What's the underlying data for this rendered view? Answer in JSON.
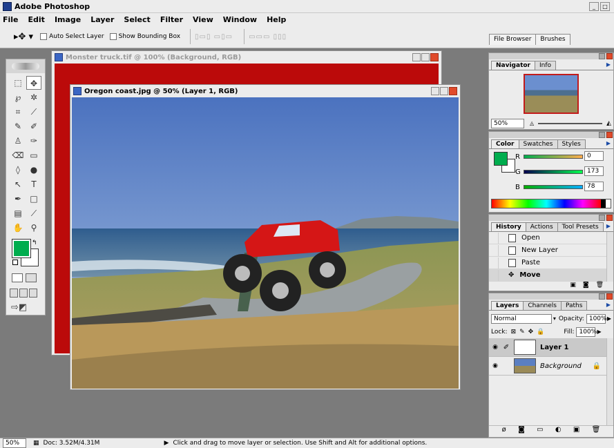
{
  "app": {
    "title": "Adobe Photoshop"
  },
  "menu": [
    "File",
    "Edit",
    "Image",
    "Layer",
    "Select",
    "Filter",
    "View",
    "Window",
    "Help"
  ],
  "options": {
    "auto_select": "Auto Select Layer",
    "show_bounding": "Show Bounding Box"
  },
  "palette_well": {
    "tabs": [
      "File Browser",
      "Brushes"
    ]
  },
  "documents": {
    "back": {
      "title": "Monster truck.tif @ 100% (Background, RGB)"
    },
    "front": {
      "title": "Oregon coast.jpg @ 50% (Layer 1, RGB)"
    }
  },
  "navigator": {
    "tabs": [
      "Navigator",
      "Info"
    ],
    "zoom": "50%"
  },
  "color": {
    "tabs": [
      "Color",
      "Swatches",
      "Styles"
    ],
    "r_label": "R",
    "g_label": "G",
    "b_label": "B",
    "r": "0",
    "g": "173",
    "b": "78",
    "fg_color": "#00ad4e"
  },
  "history": {
    "tabs": [
      "History",
      "Actions",
      "Tool Presets"
    ],
    "items": [
      "Open",
      "New Layer",
      "Paste",
      "Move"
    ]
  },
  "layers": {
    "tabs": [
      "Layers",
      "Channels",
      "Paths"
    ],
    "blend": "Normal",
    "opacity_label": "Opacity:",
    "opacity": "100%",
    "lock_label": "Lock:",
    "fill_label": "Fill:",
    "fill": "100%",
    "items": [
      "Layer 1",
      "Background"
    ]
  },
  "status": {
    "zoom": "50%",
    "doc": "Doc: 3.52M/4.31M",
    "hint": "Click and drag to move layer or selection. Use Shift and Alt for additional options."
  }
}
